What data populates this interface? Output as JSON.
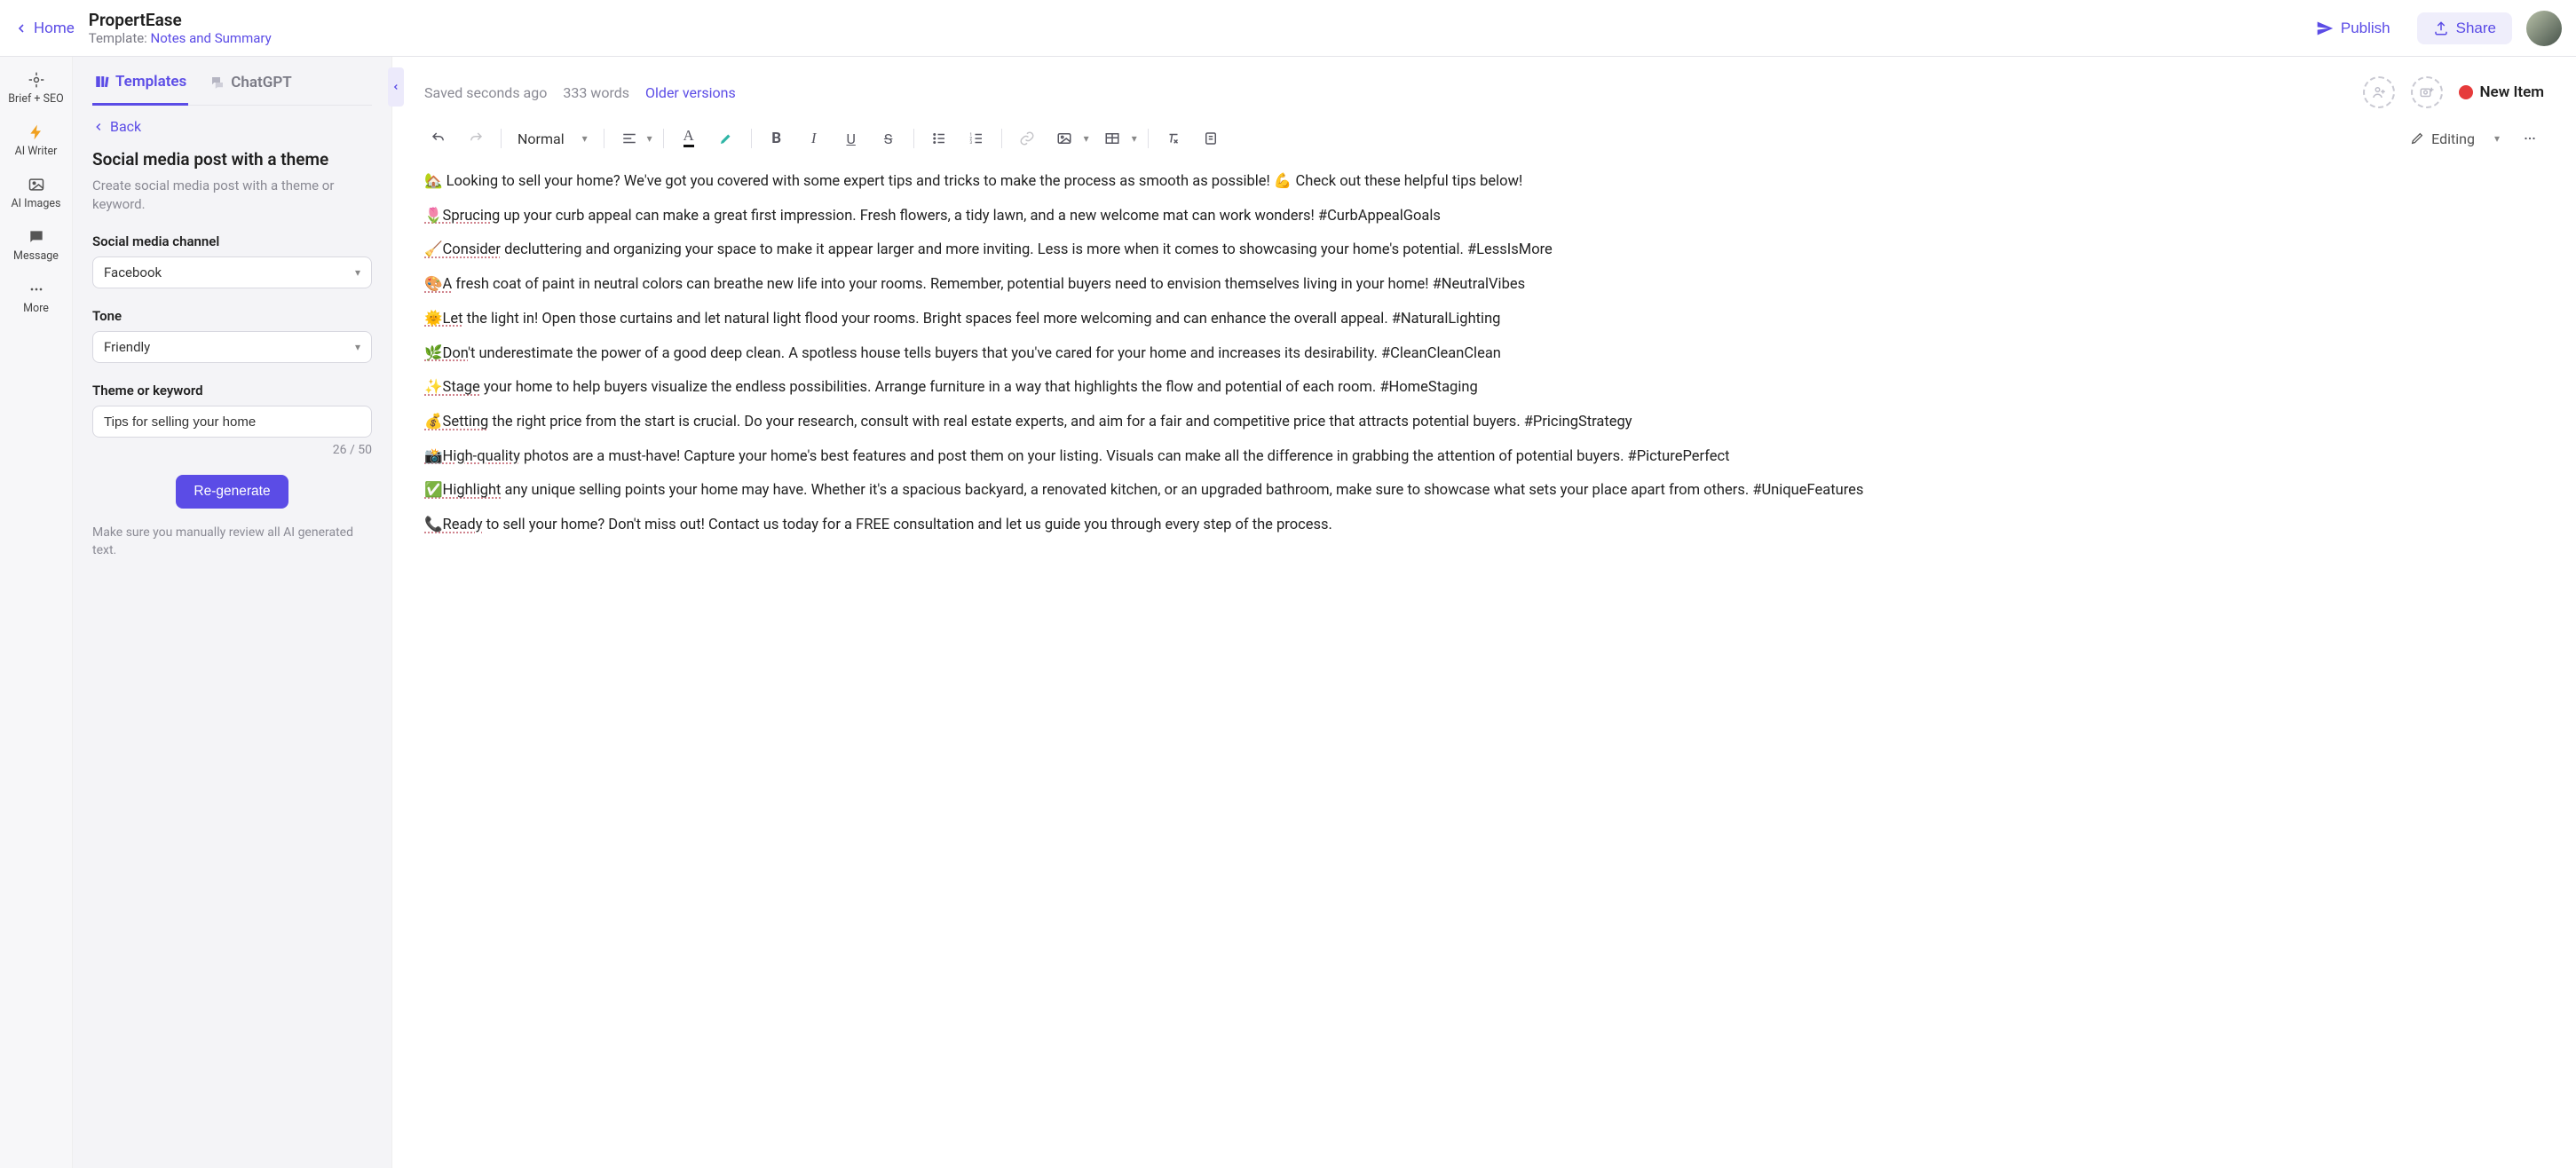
{
  "header": {
    "home": "Home",
    "title": "PropertEase",
    "template_prefix": "Template: ",
    "template_name": "Notes and Summary",
    "publish": "Publish",
    "share": "Share"
  },
  "rail": {
    "brief": "Brief + SEO",
    "writer": "AI Writer",
    "images": "AI Images",
    "message": "Message",
    "more": "More"
  },
  "sidepanel": {
    "tab_templates": "Templates",
    "tab_chatgpt": "ChatGPT",
    "back": "Back",
    "heading": "Social media post with a theme",
    "desc": "Create social media post with a theme or keyword.",
    "label_channel": "Social media channel",
    "value_channel": "Facebook",
    "label_tone": "Tone",
    "value_tone": "Friendly",
    "label_theme": "Theme or keyword",
    "value_theme": "Tips for selling your home",
    "char_count": "26 / 50",
    "regen": "Re-generate",
    "review_hint": "Make sure you manually review all AI generated text."
  },
  "status": {
    "saved": "Saved seconds ago",
    "words": "333 words",
    "older": "Older versions",
    "new_item": "New Item"
  },
  "toolbar": {
    "format": "Normal",
    "mode": "Editing"
  },
  "doc": {
    "p1": "🏡 Looking to sell your home? We've got you covered with some expert tips and tricks to make the process as smooth as possible! 💪 Check out these helpful tips below!",
    "p2a": "🌷Sprucing",
    "p2b": " up your curb appeal can make a great first impression. Fresh flowers, a tidy lawn, and a new welcome mat can work wonders! #CurbAppealGoals",
    "p3a": "🧹Consider",
    "p3b": " decluttering and organizing your space to make it appear larger and more inviting. Less is more when it comes to showcasing your home's potential. #LessIsMore",
    "p4a": "🎨A",
    "p4b": " fresh coat of paint in neutral colors can breathe new life into your rooms. Remember, potential buyers need to envision themselves living in your home! #NeutralVibes",
    "p5a": "🌞Let",
    "p5b": " the light in! Open those curtains and let natural light flood your rooms. Bright spaces feel more welcoming and can enhance the overall appeal. #NaturalLighting",
    "p6a": "🌿Don",
    "p6b": "'t underestimate the power of a good deep clean. A spotless house tells buyers that you've cared for your home and increases its desirability. #CleanCleanClean",
    "p7a": "✨Stage",
    "p7b": " your home to help buyers visualize the endless possibilities. Arrange furniture in a way that highlights the flow and potential of each room. #HomeStaging",
    "p8a": "💰Setting",
    "p8b": " the right price from the start is crucial. Do your research, consult with real estate experts, and aim for a fair and competitive price that attracts potential buyers. #PricingStrategy",
    "p9a": "📸High-quality",
    "p9b": " photos are a must-have! Capture your home's best features and post them on your listing. Visuals can make all the difference in grabbing the attention of potential buyers. #PicturePerfect",
    "p10a": "✅Highlight",
    "p10b": " any unique selling points your home may have. Whether it's a spacious backyard, a renovated kitchen, or an upgraded bathroom, make sure to showcase what sets your place apart from others. #UniqueFeatures",
    "p11a": "📞Ready",
    "p11b": " to sell your home? Don't miss out! Contact us today for a FREE consultation and let us guide you through every step of the process."
  }
}
